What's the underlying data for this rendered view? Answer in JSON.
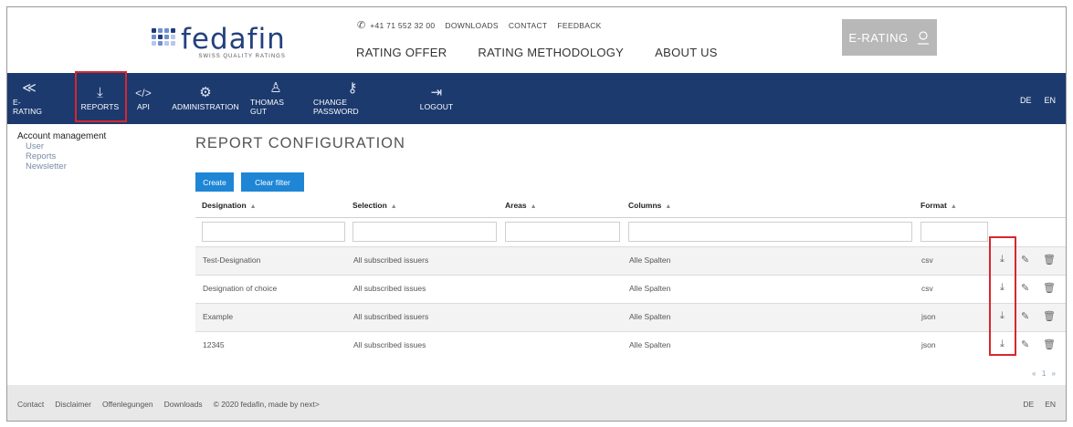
{
  "header": {
    "logo_text": "fedafin",
    "logo_sub": "SWISS QUALITY RATINGS",
    "phone": "+41 71 552 32 00",
    "top_links": [
      "DOWNLOADS",
      "CONTACT",
      "FEEDBACK"
    ],
    "main_nav": [
      "RATING OFFER",
      "RATING METHODOLOGY",
      "ABOUT US"
    ],
    "erating_button": "E-RATING"
  },
  "toolbar": {
    "items": [
      {
        "label": "E-RATING",
        "icon": "double-chevron-left-icon",
        "glyph": "≪"
      },
      {
        "label": "REPORTS",
        "icon": "download-icon",
        "glyph": "⤓"
      },
      {
        "label": "API",
        "icon": "code-icon",
        "glyph": "</>"
      },
      {
        "label": "ADMINISTRATION",
        "icon": "gear-icon",
        "glyph": "⚙"
      },
      {
        "label": "THOMAS GUT",
        "icon": "user-icon",
        "glyph": "♙"
      },
      {
        "label": "CHANGE PASSWORD",
        "icon": "key-icon",
        "glyph": "⚷"
      },
      {
        "label": "LOGOUT",
        "icon": "logout-icon",
        "glyph": "⇥"
      }
    ],
    "lang": [
      "DE",
      "EN"
    ]
  },
  "sidebar": {
    "title": "Account management",
    "items": [
      "User",
      "Reports",
      "Newsletter"
    ]
  },
  "main": {
    "title": "REPORT CONFIGURATION",
    "create_label": "Create",
    "clear_filter_label": "Clear filter",
    "columns": [
      "Designation",
      "Selection",
      "Areas",
      "Columns",
      "Format"
    ],
    "rows": [
      {
        "designation": "Test-Designation",
        "selection": "All subscribed issuers",
        "areas": "",
        "columns": "Alle Spalten",
        "format": "csv"
      },
      {
        "designation": "Designation of choice",
        "selection": "All subscribed issues",
        "areas": "",
        "columns": "Alle Spalten",
        "format": "csv"
      },
      {
        "designation": "Example",
        "selection": "All subscribed issuers",
        "areas": "",
        "columns": "Alle Spalten",
        "format": "json"
      },
      {
        "designation": "12345",
        "selection": "All subscribed issues",
        "areas": "",
        "columns": "Alle Spalten",
        "format": "json"
      }
    ],
    "pager": {
      "prev": "«",
      "page": "1",
      "next": "»"
    }
  },
  "footer": {
    "links": [
      "Contact",
      "Disclaimer",
      "Offenlegungen",
      "Downloads",
      "© 2020 fedafin, made by next>"
    ],
    "lang": [
      "DE",
      "EN"
    ]
  },
  "colors": {
    "toolbar_bg": "#1c3a6e",
    "accent_button": "#1f86d6",
    "highlight": "#d9262c",
    "erating_bg": "#b8b8b8",
    "footer_bg": "#e8e8e8"
  }
}
